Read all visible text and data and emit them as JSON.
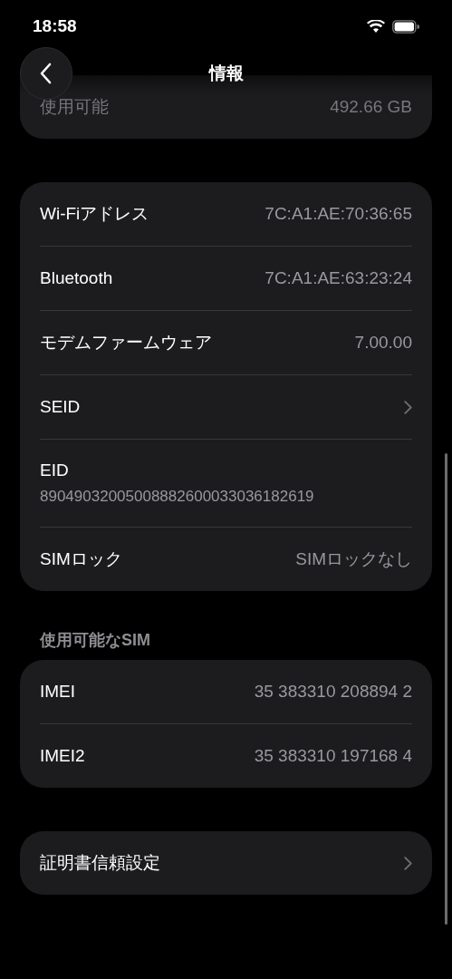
{
  "status_bar": {
    "time": "18:58"
  },
  "nav": {
    "title": "情報"
  },
  "groups": [
    {
      "partial": true,
      "rows": [
        {
          "kind": "value",
          "label": "使用可能",
          "value": "492.66 GB"
        }
      ]
    },
    {
      "partial": false,
      "rows": [
        {
          "kind": "value",
          "label": "Wi-Fiアドレス",
          "value": "7C:A1:AE:70:36:65"
        },
        {
          "kind": "value",
          "label": "Bluetooth",
          "value": "7C:A1:AE:63:23:24"
        },
        {
          "kind": "value",
          "label": "モデムファームウェア",
          "value": "7.00.00"
        },
        {
          "kind": "chevron",
          "label": "SEID"
        },
        {
          "kind": "subtitle",
          "label": "EID",
          "value": "89049032005008882600033036182619"
        },
        {
          "kind": "value",
          "label": "SIMロック",
          "value": "SIMロックなし"
        }
      ]
    },
    {
      "header": "使用可能なSIM",
      "partial": false,
      "rows": [
        {
          "kind": "value",
          "label": "IMEI",
          "value": "35 383310 208894 2"
        },
        {
          "kind": "value",
          "label": "IMEI2",
          "value": "35 383310 197168 4"
        }
      ]
    },
    {
      "partial": false,
      "rows": [
        {
          "kind": "chevron",
          "label": "証明書信頼設定"
        }
      ]
    }
  ]
}
